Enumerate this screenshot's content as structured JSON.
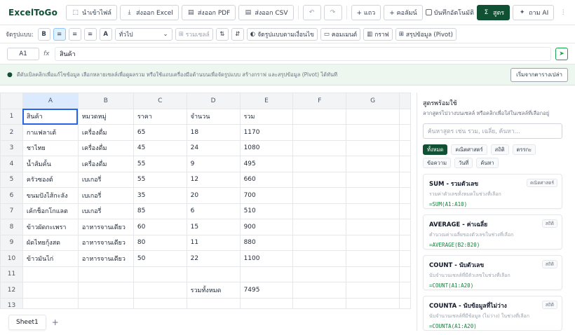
{
  "app": {
    "logo": "ExcelToGo"
  },
  "toolbar": {
    "import_label": "นำเข้าไฟล์",
    "export_excel_label": "ส่งออก Excel",
    "export_pdf_label": "ส่งออก PDF",
    "export_csv_label": "ส่งออก CSV",
    "add_row_label": "+ แถว",
    "add_col_label": "+ คอลัมน์",
    "autosave_label": "บันทึกอัตโนมัติ",
    "formula_label": "สูตร",
    "ask_ai_label": "ถาม AI"
  },
  "format": {
    "label": "จัดรูปแบบ:",
    "font_select": "ทั่วไป",
    "merge_label": "รวมเซลล์",
    "conditional_label": "จัดรูปแบบตามเงื่อนไข",
    "comment_label": "คอมเมนต์",
    "chart_label": "กราฟ",
    "pivot_label": "สรุปข้อมูล (Pivot)"
  },
  "formula_bar": {
    "cell_ref": "A1",
    "fx": "fx",
    "value": "สินค้า"
  },
  "hint": {
    "text": "ดีดับเบิลคลิกเพื่อแก้ไขข้อมูล เลือกหลายเซลล์เพื่อดูผลรวม หรือใช้แถบเครื่องมือด้านบนเพื่อจัดรูปแบบ สร้างกราฟ และสรุปข้อมูล (Pivot) ได้ทันที",
    "button": "เริ่มจากตารางเปล่า"
  },
  "grid": {
    "columns": [
      "A",
      "B",
      "C",
      "D",
      "E",
      "F",
      "G"
    ],
    "rows": [
      [
        "สินค้า",
        "หมวดหมู่",
        "ราคา",
        "จำนวน",
        "รวม",
        "",
        ""
      ],
      [
        "กาแฟลาเต้",
        "เครื่องดื่ม",
        "65",
        "18",
        "1170",
        "",
        ""
      ],
      [
        "ชาไทย",
        "เครื่องดื่ม",
        "45",
        "24",
        "1080",
        "",
        ""
      ],
      [
        "น้ำส้มคั้น",
        "เครื่องดื่ม",
        "55",
        "9",
        "495",
        "",
        ""
      ],
      [
        "ครัวซองต์",
        "เบเกอรี่",
        "55",
        "12",
        "660",
        "",
        ""
      ],
      [
        "ขนมปังไส้กะลัง",
        "เบเกอรี่",
        "35",
        "20",
        "700",
        "",
        ""
      ],
      [
        "เค้กช็อกโกแลต",
        "เบเกอรี่",
        "85",
        "6",
        "510",
        "",
        ""
      ],
      [
        "ข้าวผัดกะเพรา",
        "อาหารจานเดียว",
        "60",
        "15",
        "900",
        "",
        ""
      ],
      [
        "ผัดไทยกุ้งสด",
        "อาหารจานเดียว",
        "80",
        "11",
        "880",
        "",
        ""
      ],
      [
        "ข้าวมันไก่",
        "อาหารจานเดียว",
        "50",
        "22",
        "1100",
        "",
        ""
      ],
      [
        "",
        "",
        "",
        "",
        "",
        "",
        ""
      ],
      [
        "",
        "",
        "",
        "รวมทั้งหมด",
        "7495",
        "",
        ""
      ],
      [
        "",
        "",
        "",
        "",
        "",
        "",
        ""
      ]
    ]
  },
  "sheets": {
    "active": "Sheet1",
    "add": "+"
  },
  "panel": {
    "title": "สูตรพร้อมใช้",
    "subtitle": "ลากสูตรไปวางบนเซลล์ หรือคลิกเพื่อใส่ในเซลล์ที่เลือกอยู่",
    "search_placeholder": "ค้นหาสูตร เช่น รวม, เฉลี่ย, ค้นหา...",
    "chips": [
      "ทั้งหมด",
      "คณิตศาสตร์",
      "สถิติ",
      "ตรรกะ",
      "ข้อความ",
      "วันที่",
      "ค้นหา"
    ],
    "cards": [
      {
        "title": "SUM - รวมตัวเลข",
        "desc": "รวมค่าตัวเลขทั้งหมดในช่วงที่เลือก",
        "example": "=SUM(A1:A10)",
        "badge": "คณิตศาสตร์"
      },
      {
        "title": "AVERAGE - ค่าเฉลี่ย",
        "desc": "คำนวณค่าเฉลี่ยของตัวเลขในช่วงที่เลือก",
        "example": "=AVERAGE(B2:B20)",
        "badge": "สถิติ"
      },
      {
        "title": "COUNT - นับตัวเลข",
        "desc": "นับจำนวนเซลล์ที่มีตัวเลขในช่วงที่เลือก",
        "example": "=COUNT(A1:A20)",
        "badge": "สถิติ"
      },
      {
        "title": "COUNTA - นับข้อมูลที่ไม่ว่าง",
        "desc": "นับจำนวนเซลล์ที่มีข้อมูล (ไม่ว่าง) ในช่วงที่เลือก",
        "example": "=COUNTA(A1:A20)",
        "badge": "สถิติ"
      }
    ]
  }
}
